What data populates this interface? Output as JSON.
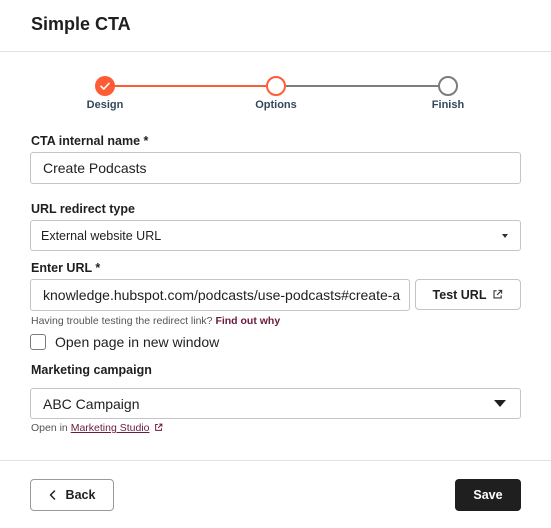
{
  "dialog": {
    "title": "Simple CTA"
  },
  "stepper": {
    "steps": [
      {
        "label": "Design",
        "state": "complete"
      },
      {
        "label": "Options",
        "state": "current"
      },
      {
        "label": "Finish",
        "state": "upcoming"
      }
    ],
    "accent_color": "#ff5c35",
    "upcoming_color": "#7c7c7c"
  },
  "fields": {
    "internal_name": {
      "label": "CTA internal name *",
      "value": "Create Podcasts"
    },
    "redirect_type": {
      "label": "URL redirect type",
      "value": "External website URL"
    },
    "url": {
      "label": "Enter URL *",
      "value": "knowledge.hubspot.com/podcasts/use-podcasts#create-a"
    },
    "test_url_button": {
      "label": "Test URL",
      "icon": "external-link-icon"
    },
    "hint": {
      "text": "Having trouble testing the redirect link?",
      "link": "Find out why"
    },
    "new_window": {
      "label": "Open page in new window",
      "checked": false
    },
    "campaign": {
      "label": "Marketing campaign",
      "value": "ABC Campaign"
    },
    "studio_hint": {
      "prefix": "Open in",
      "link": "Marketing Studio",
      "icon": "external-link-icon"
    }
  },
  "footer": {
    "back_label": "Back",
    "save_label": "Save",
    "save_color": "#1f1f1f"
  },
  "link_color": "#6b1b3f"
}
